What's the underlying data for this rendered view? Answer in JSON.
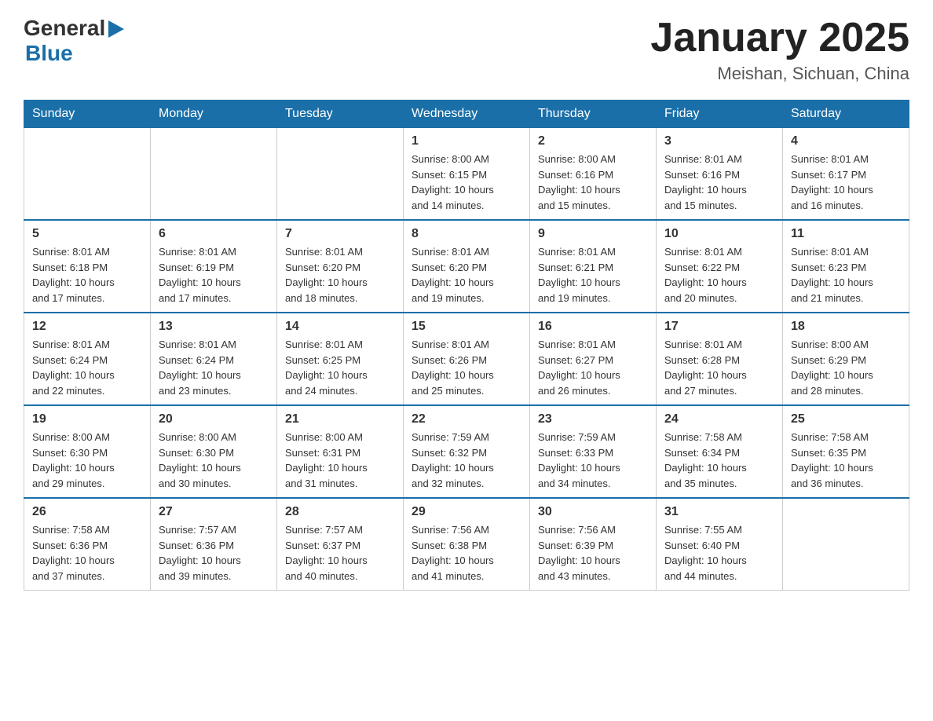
{
  "header": {
    "logo_general": "General",
    "logo_blue": "Blue",
    "month_title": "January 2025",
    "location": "Meishan, Sichuan, China"
  },
  "weekdays": [
    "Sunday",
    "Monday",
    "Tuesday",
    "Wednesday",
    "Thursday",
    "Friday",
    "Saturday"
  ],
  "weeks": [
    [
      {
        "day": "",
        "info": ""
      },
      {
        "day": "",
        "info": ""
      },
      {
        "day": "",
        "info": ""
      },
      {
        "day": "1",
        "info": "Sunrise: 8:00 AM\nSunset: 6:15 PM\nDaylight: 10 hours\nand 14 minutes."
      },
      {
        "day": "2",
        "info": "Sunrise: 8:00 AM\nSunset: 6:16 PM\nDaylight: 10 hours\nand 15 minutes."
      },
      {
        "day": "3",
        "info": "Sunrise: 8:01 AM\nSunset: 6:16 PM\nDaylight: 10 hours\nand 15 minutes."
      },
      {
        "day": "4",
        "info": "Sunrise: 8:01 AM\nSunset: 6:17 PM\nDaylight: 10 hours\nand 16 minutes."
      }
    ],
    [
      {
        "day": "5",
        "info": "Sunrise: 8:01 AM\nSunset: 6:18 PM\nDaylight: 10 hours\nand 17 minutes."
      },
      {
        "day": "6",
        "info": "Sunrise: 8:01 AM\nSunset: 6:19 PM\nDaylight: 10 hours\nand 17 minutes."
      },
      {
        "day": "7",
        "info": "Sunrise: 8:01 AM\nSunset: 6:20 PM\nDaylight: 10 hours\nand 18 minutes."
      },
      {
        "day": "8",
        "info": "Sunrise: 8:01 AM\nSunset: 6:20 PM\nDaylight: 10 hours\nand 19 minutes."
      },
      {
        "day": "9",
        "info": "Sunrise: 8:01 AM\nSunset: 6:21 PM\nDaylight: 10 hours\nand 19 minutes."
      },
      {
        "day": "10",
        "info": "Sunrise: 8:01 AM\nSunset: 6:22 PM\nDaylight: 10 hours\nand 20 minutes."
      },
      {
        "day": "11",
        "info": "Sunrise: 8:01 AM\nSunset: 6:23 PM\nDaylight: 10 hours\nand 21 minutes."
      }
    ],
    [
      {
        "day": "12",
        "info": "Sunrise: 8:01 AM\nSunset: 6:24 PM\nDaylight: 10 hours\nand 22 minutes."
      },
      {
        "day": "13",
        "info": "Sunrise: 8:01 AM\nSunset: 6:24 PM\nDaylight: 10 hours\nand 23 minutes."
      },
      {
        "day": "14",
        "info": "Sunrise: 8:01 AM\nSunset: 6:25 PM\nDaylight: 10 hours\nand 24 minutes."
      },
      {
        "day": "15",
        "info": "Sunrise: 8:01 AM\nSunset: 6:26 PM\nDaylight: 10 hours\nand 25 minutes."
      },
      {
        "day": "16",
        "info": "Sunrise: 8:01 AM\nSunset: 6:27 PM\nDaylight: 10 hours\nand 26 minutes."
      },
      {
        "day": "17",
        "info": "Sunrise: 8:01 AM\nSunset: 6:28 PM\nDaylight: 10 hours\nand 27 minutes."
      },
      {
        "day": "18",
        "info": "Sunrise: 8:00 AM\nSunset: 6:29 PM\nDaylight: 10 hours\nand 28 minutes."
      }
    ],
    [
      {
        "day": "19",
        "info": "Sunrise: 8:00 AM\nSunset: 6:30 PM\nDaylight: 10 hours\nand 29 minutes."
      },
      {
        "day": "20",
        "info": "Sunrise: 8:00 AM\nSunset: 6:30 PM\nDaylight: 10 hours\nand 30 minutes."
      },
      {
        "day": "21",
        "info": "Sunrise: 8:00 AM\nSunset: 6:31 PM\nDaylight: 10 hours\nand 31 minutes."
      },
      {
        "day": "22",
        "info": "Sunrise: 7:59 AM\nSunset: 6:32 PM\nDaylight: 10 hours\nand 32 minutes."
      },
      {
        "day": "23",
        "info": "Sunrise: 7:59 AM\nSunset: 6:33 PM\nDaylight: 10 hours\nand 34 minutes."
      },
      {
        "day": "24",
        "info": "Sunrise: 7:58 AM\nSunset: 6:34 PM\nDaylight: 10 hours\nand 35 minutes."
      },
      {
        "day": "25",
        "info": "Sunrise: 7:58 AM\nSunset: 6:35 PM\nDaylight: 10 hours\nand 36 minutes."
      }
    ],
    [
      {
        "day": "26",
        "info": "Sunrise: 7:58 AM\nSunset: 6:36 PM\nDaylight: 10 hours\nand 37 minutes."
      },
      {
        "day": "27",
        "info": "Sunrise: 7:57 AM\nSunset: 6:36 PM\nDaylight: 10 hours\nand 39 minutes."
      },
      {
        "day": "28",
        "info": "Sunrise: 7:57 AM\nSunset: 6:37 PM\nDaylight: 10 hours\nand 40 minutes."
      },
      {
        "day": "29",
        "info": "Sunrise: 7:56 AM\nSunset: 6:38 PM\nDaylight: 10 hours\nand 41 minutes."
      },
      {
        "day": "30",
        "info": "Sunrise: 7:56 AM\nSunset: 6:39 PM\nDaylight: 10 hours\nand 43 minutes."
      },
      {
        "day": "31",
        "info": "Sunrise: 7:55 AM\nSunset: 6:40 PM\nDaylight: 10 hours\nand 44 minutes."
      },
      {
        "day": "",
        "info": ""
      }
    ]
  ]
}
